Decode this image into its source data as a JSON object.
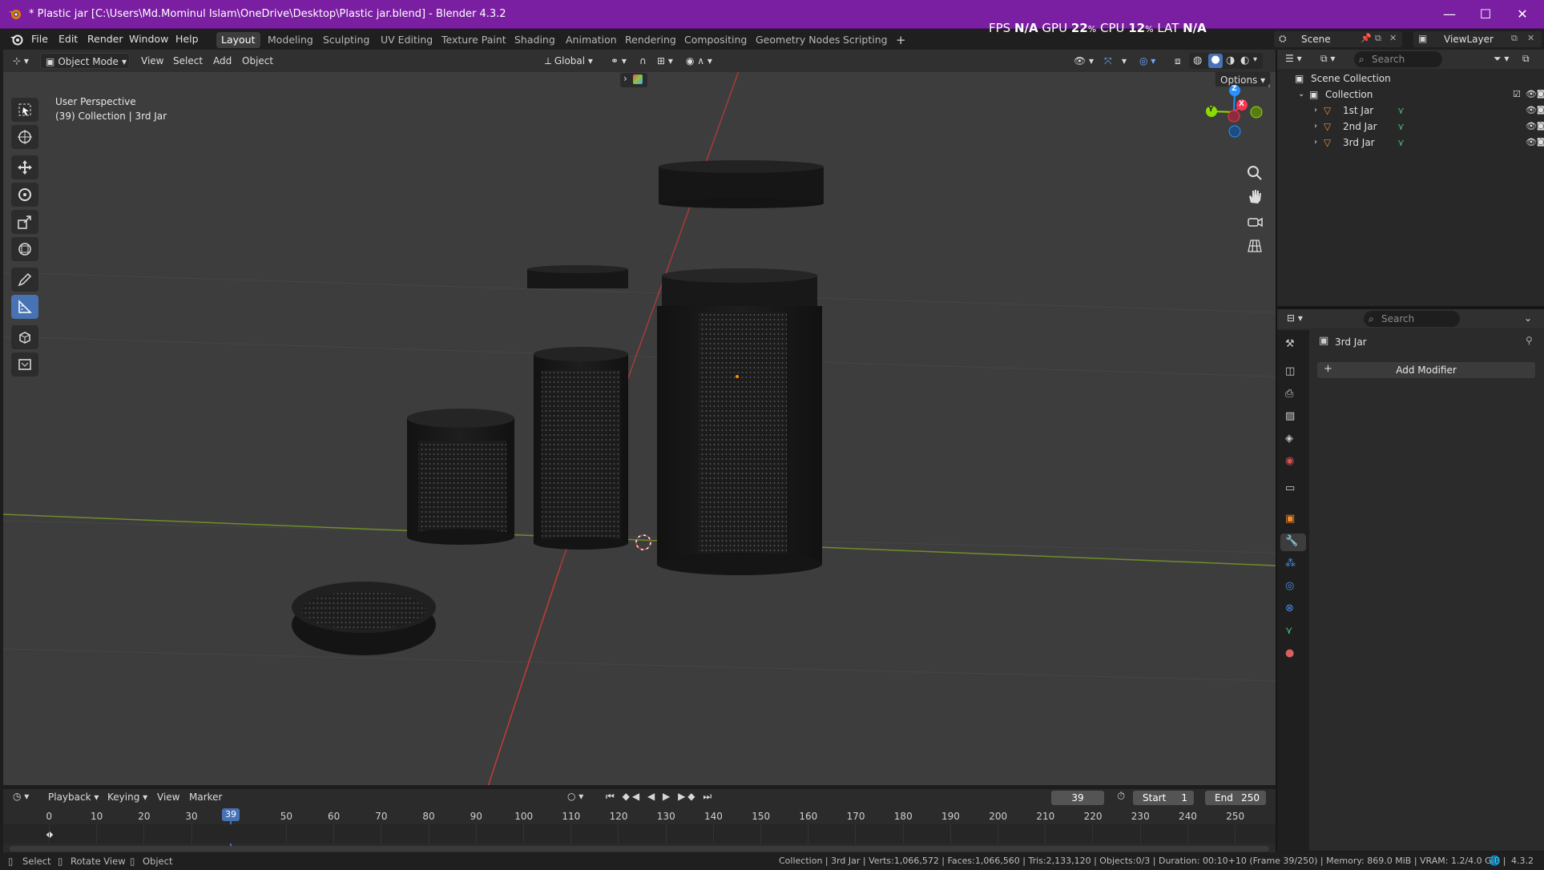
{
  "window": {
    "title": "* Plastic jar [C:\\Users\\Md.Mominul Islam\\OneDrive\\Desktop\\Plastic jar.blend] - Blender 4.3.2",
    "minimize": "—",
    "maximize": "☐",
    "close": "✕"
  },
  "menu": {
    "items": [
      "File",
      "Edit",
      "Render",
      "Window",
      "Help"
    ],
    "workspaces": [
      "Layout",
      "Modeling",
      "Sculpting",
      "UV Editing",
      "Texture Paint",
      "Shading",
      "Animation",
      "Rendering",
      "Compositing",
      "Geometry Nodes",
      "Scripting"
    ],
    "active_workspace": "Layout",
    "add_workspace": "+",
    "scene_label": "Scene",
    "viewlayer_label": "ViewLayer"
  },
  "perf": {
    "fps_label": "FPS",
    "fps_value": "N/A",
    "gpu_label": "GPU",
    "gpu_value": "22",
    "cpu_label": "CPU",
    "cpu_value": "12",
    "lat_label": "LAT",
    "lat_value": "N/A",
    "percent": "%"
  },
  "viewport_header": {
    "mode": "Object Mode",
    "view": "View",
    "select": "Select",
    "add": "Add",
    "object": "Object",
    "orientation": "Global",
    "options": "Options"
  },
  "viewport": {
    "perspective": "User Perspective",
    "context": "(39) Collection | 3rd Jar",
    "gizmo_axes": {
      "z": "Z",
      "y": "Y",
      "x": "X"
    }
  },
  "timeline": {
    "playback": "Playback",
    "keying": "Keying",
    "view": "View",
    "marker": "Marker",
    "current_frame": "39",
    "start_label": "Start",
    "start_value": "1",
    "end_label": "End",
    "end_value": "250",
    "ticks": [
      "0",
      "10",
      "20",
      "30",
      "50",
      "60",
      "70",
      "80",
      "90",
      "100",
      "110",
      "120",
      "130",
      "140",
      "150",
      "160",
      "170",
      "180",
      "190",
      "200",
      "210",
      "220",
      "230",
      "240",
      "250"
    ],
    "playhead": "39"
  },
  "status": {
    "select": "Select",
    "rotate_view": "Rotate View",
    "object": "Object",
    "info": "Collection | 3rd Jar | Verts:1,066,572 | Faces:1,066,560 | Tris:2,133,120 | Objects:0/3 | Duration: 00:10+10 (Frame 39/250) | Memory: 869.0 MiB | VRAM: 1.2/4.0 GiB |",
    "version": "4.3.2"
  },
  "outliner": {
    "search_placeholder": "Search",
    "scene_collection": "Scene Collection",
    "collection": "Collection",
    "objects": [
      "1st Jar",
      "2nd Jar",
      "3rd Jar"
    ]
  },
  "properties": {
    "search_placeholder": "Search",
    "object_name": "3rd Jar",
    "add_modifier": "Add Modifier"
  },
  "colors": {
    "accent": "#4772b3",
    "title_bar": "#7b1fa2",
    "x_axis": "#ff3352",
    "y_axis": "#8bdc00",
    "z_axis": "#2890ff"
  }
}
